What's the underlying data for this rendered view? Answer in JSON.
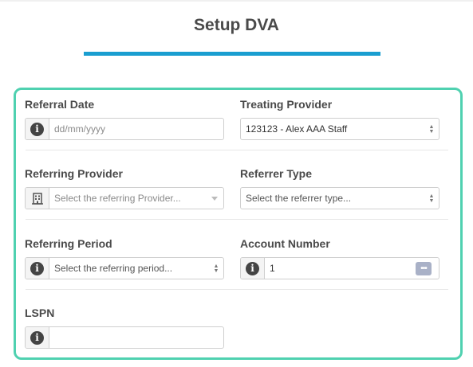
{
  "page": {
    "title": "Setup DVA"
  },
  "colors": {
    "accent": "#1a9ed0",
    "card_border": "#4fd1b0",
    "dots_button": "#a9b1c7"
  },
  "form": {
    "referral_date": {
      "label": "Referral Date",
      "placeholder": "dd/mm/yyyy",
      "icon": "info-icon"
    },
    "treating_provider": {
      "label": "Treating Provider",
      "value": "123123 - Alex AAA Staff"
    },
    "referring_provider": {
      "label": "Referring Provider",
      "placeholder": "Select the referring Provider...",
      "icon": "building-icon"
    },
    "referrer_type": {
      "label": "Referrer Type",
      "placeholder": "Select the referrer type..."
    },
    "referring_period": {
      "label": "Referring Period",
      "placeholder": "Select the referring period...",
      "icon": "info-icon"
    },
    "account_number": {
      "label": "Account Number",
      "value": "1",
      "icon": "info-icon",
      "button_icon": "more-dots-icon"
    },
    "lspn": {
      "label": "LSPN",
      "value": "",
      "icon": "info-icon"
    }
  }
}
